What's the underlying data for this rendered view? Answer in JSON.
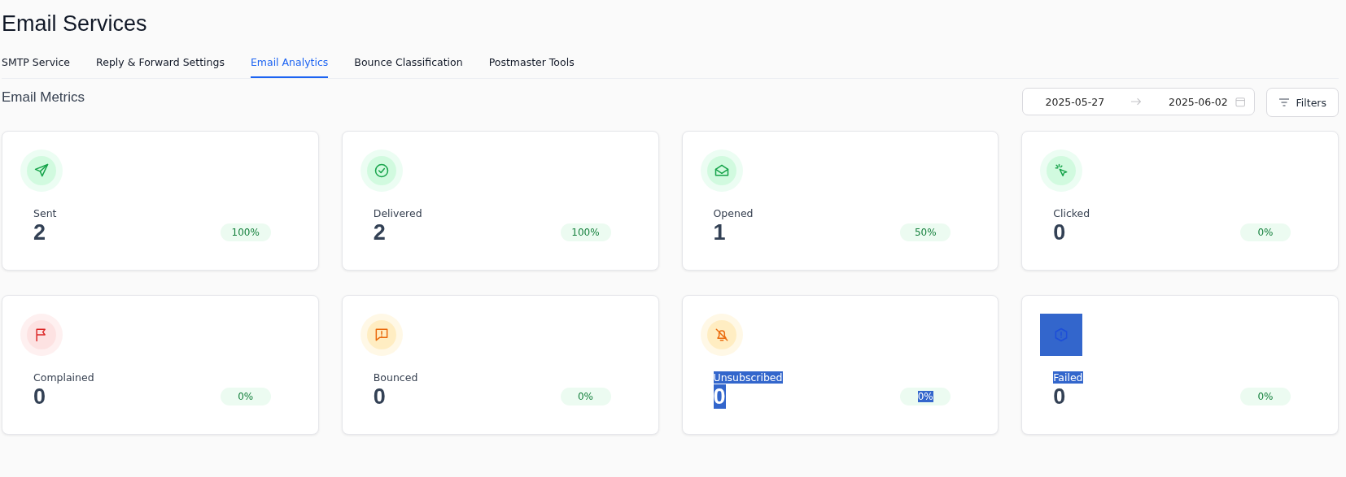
{
  "page": {
    "title": "Email Services"
  },
  "tabs": [
    {
      "label": "SMTP Service",
      "selected": false
    },
    {
      "label": "Reply & Forward Settings",
      "selected": false
    },
    {
      "label": "Email Analytics",
      "selected": true
    },
    {
      "label": "Bounce Classification",
      "selected": false
    },
    {
      "label": "Postmaster Tools",
      "selected": false
    }
  ],
  "section": {
    "title": "Email Metrics"
  },
  "date_range": {
    "start": "2025-05-27",
    "end": "2025-06-02"
  },
  "filters_button": {
    "label": "Filters"
  },
  "metrics": [
    {
      "kind": "send",
      "label": "Sent",
      "value": "2",
      "percent": "100%",
      "icon_selected": false,
      "label_selected": false,
      "value_selected": false,
      "percent_selected": false
    },
    {
      "kind": "check",
      "label": "Delivered",
      "value": "2",
      "percent": "100%",
      "icon_selected": false,
      "label_selected": false,
      "value_selected": false,
      "percent_selected": false
    },
    {
      "kind": "mail",
      "label": "Opened",
      "value": "1",
      "percent": "50%",
      "icon_selected": false,
      "label_selected": false,
      "value_selected": false,
      "percent_selected": false
    },
    {
      "kind": "click",
      "label": "Clicked",
      "value": "0",
      "percent": "0%",
      "icon_selected": false,
      "label_selected": false,
      "value_selected": false,
      "percent_selected": false
    },
    {
      "kind": "flag",
      "label": "Complained",
      "value": "0",
      "percent": "0%",
      "icon_selected": false,
      "label_selected": false,
      "value_selected": false,
      "percent_selected": false
    },
    {
      "kind": "bounce",
      "label": "Bounced",
      "value": "0",
      "percent": "0%",
      "icon_selected": false,
      "label_selected": false,
      "value_selected": false,
      "percent_selected": false
    },
    {
      "kind": "unsubscribe",
      "label": "Unsubscribed",
      "value": "0",
      "percent": "0%",
      "icon_selected": false,
      "label_selected": true,
      "value_selected": true,
      "percent_selected": true
    },
    {
      "kind": "fail",
      "label": "Failed",
      "value": "0",
      "percent": "0%",
      "icon_selected": true,
      "label_selected": true,
      "value_selected": false,
      "percent_selected": false
    }
  ]
}
